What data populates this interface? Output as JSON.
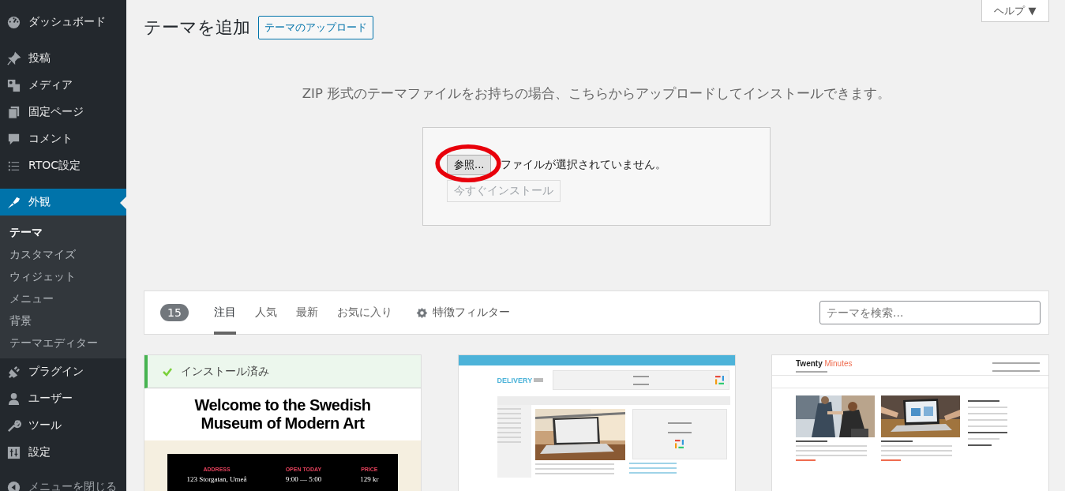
{
  "sidebar": {
    "groups": [
      [
        {
          "kind": "gauge",
          "label": "ダッシュボード",
          "selected": false
        }
      ],
      [
        {
          "kind": "pin",
          "label": "投稿",
          "selected": false
        },
        {
          "kind": "media",
          "label": "メディア",
          "selected": false
        },
        {
          "kind": "pages",
          "label": "固定ページ",
          "selected": false
        },
        {
          "kind": "comment",
          "label": "コメント",
          "selected": false
        },
        {
          "kind": "list",
          "label": "RTOC設定",
          "selected": false
        }
      ],
      [
        {
          "kind": "brush",
          "label": "外観",
          "selected": true,
          "children": [
            {
              "label": "テーマ",
              "selected": true
            },
            {
              "label": "カスタマイズ",
              "selected": false
            },
            {
              "label": "ウィジェット",
              "selected": false
            },
            {
              "label": "メニュー",
              "selected": false
            },
            {
              "label": "背景",
              "selected": false
            },
            {
              "label": "テーマエディター",
              "selected": false
            }
          ]
        },
        {
          "kind": "plug",
          "label": "プラグイン",
          "selected": false
        },
        {
          "kind": "user",
          "label": "ユーザー",
          "selected": false
        },
        {
          "kind": "wrench",
          "label": "ツール",
          "selected": false
        },
        {
          "kind": "sliders",
          "label": "設定",
          "selected": false
        }
      ]
    ],
    "collapse": "メニューを閉じる"
  },
  "help": "ヘルプ ▼",
  "title": "テーマを追加",
  "upload_button": "テーマのアップロード",
  "upload": {
    "intro": "ZIP 形式のテーマファイルをお持ちの場合、こちらからアップロードしてインストールできます。",
    "browse": "参照...",
    "no_file": "ファイルが選択されていません。",
    "install": "今すぐインストール",
    "install_disabled": true
  },
  "filter": {
    "count": "15",
    "tabs": [
      {
        "label": "注目",
        "selected": true
      },
      {
        "label": "人気",
        "selected": false
      },
      {
        "label": "最新",
        "selected": false
      },
      {
        "label": "お気に入り",
        "selected": false
      }
    ],
    "feature_filter": "特徴フィルター",
    "search_placeholder": "テーマを検索..."
  },
  "themes": [
    {
      "kind": "museum",
      "installed": true,
      "notice": "インストール済み",
      "heading": "Welcome to the Swedish Museum of Modern Art",
      "info": [
        {
          "label": "ADDRESS",
          "value": "123 Storgatan, Umeå"
        },
        {
          "label": "OPEN TODAY",
          "value": "9:00 — 5:00"
        },
        {
          "label": "PRICE",
          "value": "129 kr"
        }
      ]
    },
    {
      "kind": "delivery",
      "installed": false,
      "logo": "DELIVERY"
    },
    {
      "kind": "minutes",
      "installed": false,
      "brand": "Twenty",
      "brand_accent": "Minutes"
    }
  ]
}
